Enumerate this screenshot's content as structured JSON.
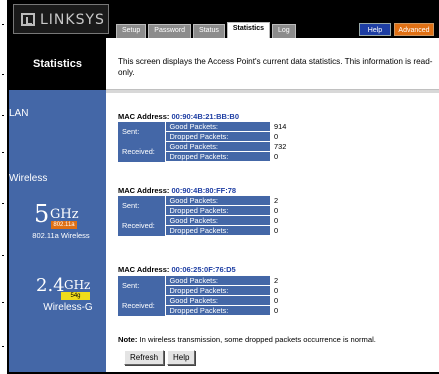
{
  "header": {
    "brand": "LINKSYS",
    "tabs": [
      {
        "label": "Setup"
      },
      {
        "label": "Password"
      },
      {
        "label": "Status"
      },
      {
        "label": "Statistics"
      },
      {
        "label": "Log"
      }
    ],
    "help_label": "Help",
    "advanced_label": "Advanced"
  },
  "page": {
    "title": "Statistics",
    "description": "This screen displays the Access Point's current data statistics. This information is read-only."
  },
  "sidebar": {
    "lan_label": "LAN",
    "wireless_label": "Wireless",
    "badge_5ghz": {
      "big": "5",
      "unit": "GHz",
      "pill": "802.11a",
      "caption": "802.11a Wireless"
    },
    "badge_24ghz": {
      "big": "2.4",
      "unit": "GHz",
      "pill": "54g",
      "caption": "Wireless-G"
    }
  },
  "sections": [
    {
      "mac_label": "MAC Address:",
      "mac": "00:90:4B:21:BB:B0",
      "sent_label": "Sent:",
      "received_label": "Received:",
      "good_label": "Good Packets:",
      "dropped_label": "Dropped Packets:",
      "sent_good": "914",
      "sent_dropped": "0",
      "received_good": "732",
      "received_dropped": "0"
    },
    {
      "mac_label": "MAC Address:",
      "mac": "00:90:4B:80:FF:78",
      "sent_label": "Sent:",
      "received_label": "Received:",
      "good_label": "Good Packets:",
      "dropped_label": "Dropped Packets:",
      "sent_good": "2",
      "sent_dropped": "0",
      "received_good": "0",
      "received_dropped": "0"
    },
    {
      "mac_label": "MAC Address:",
      "mac": "00:06:25:0F:76:D5",
      "sent_label": "Sent:",
      "received_label": "Received:",
      "good_label": "Good Packets:",
      "dropped_label": "Dropped Packets:",
      "sent_good": "2",
      "sent_dropped": "0",
      "received_good": "0",
      "received_dropped": "0"
    }
  ],
  "note": {
    "prefix": "Note:",
    "text": " In wireless transmission, some dropped packets occurrence is normal."
  },
  "buttons": {
    "refresh": "Refresh",
    "help": "Help"
  },
  "colors": {
    "sidebar": "#4467a7",
    "header": "#000000",
    "help": "#1e3ea3",
    "advanced": "#e07014",
    "mac_value": "#1e3ea3"
  }
}
